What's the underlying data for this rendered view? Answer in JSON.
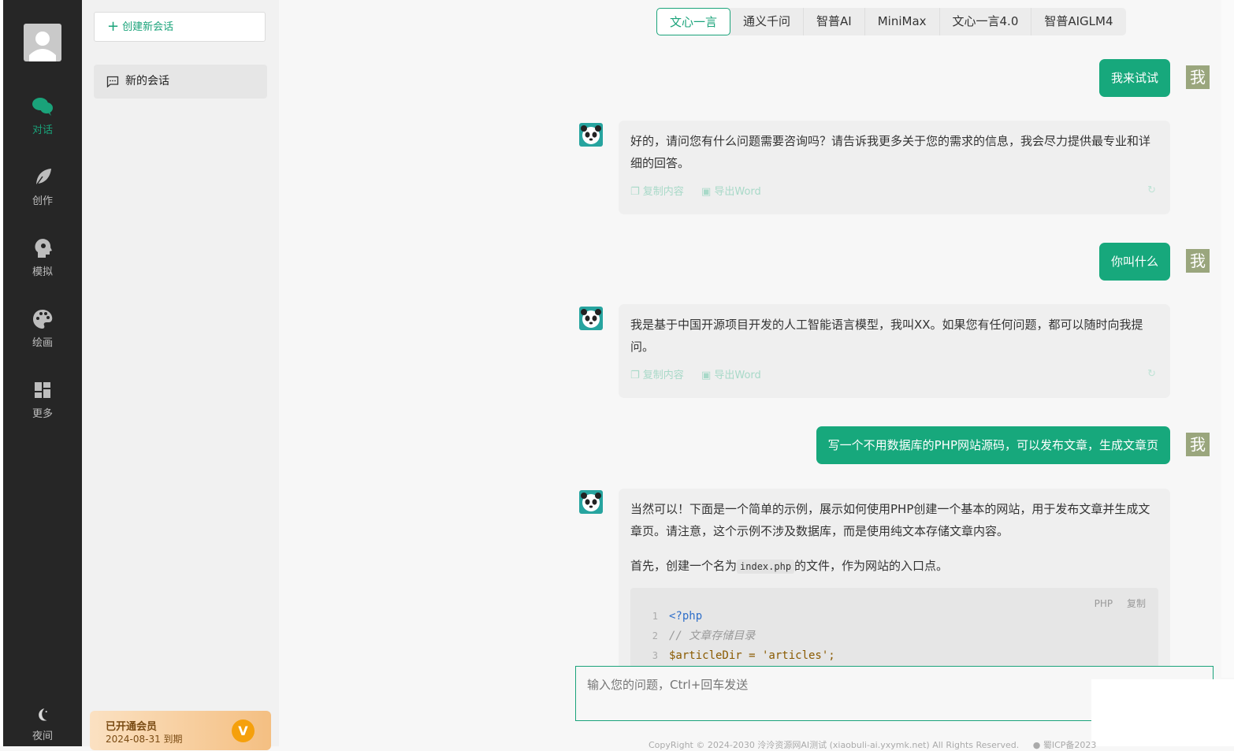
{
  "nav": {
    "items": [
      {
        "label": "对话",
        "icon": "chat-bubbles-icon",
        "active": true
      },
      {
        "label": "创作",
        "icon": "feather-icon",
        "active": false
      },
      {
        "label": "模拟",
        "icon": "head-profile-icon",
        "active": false
      },
      {
        "label": "绘画",
        "icon": "palette-icon",
        "active": false
      },
      {
        "label": "更多",
        "icon": "grid-icon",
        "active": false
      }
    ],
    "night_label": "夜间"
  },
  "sidebar": {
    "new_chat_label": "创建新会话",
    "sessions": [
      {
        "label": "新的会话"
      }
    ],
    "vip": {
      "title": "已开通会员",
      "expire": "2024-08-31 到期",
      "badge": "V"
    }
  },
  "models": {
    "tabs": [
      "文心一言",
      "通义千问",
      "智普AI",
      "MiniMax",
      "文心一言4.0",
      "智普AIGLM4"
    ],
    "active": "文心一言"
  },
  "chat": {
    "me_label": "我",
    "actions": {
      "copy": "复制内容",
      "export": "导出Word"
    },
    "messages": [
      {
        "role": "user",
        "text": "我来试试"
      },
      {
        "role": "bot",
        "text": "好的，请问您有什么问题需要咨询吗？请告诉我更多关于您的需求的信息，我会尽力提供最专业和详细的回答。"
      },
      {
        "role": "user",
        "text": "你叫什么"
      },
      {
        "role": "bot",
        "text": "我是基于中国开源项目开发的人工智能语言模型，我叫XX。如果您有任何问题，都可以随时向我提问。"
      },
      {
        "role": "user",
        "text": "写一个不用数据库的PHP网站源码，可以发布文章，生成文章页"
      },
      {
        "role": "bot",
        "text": "当然可以！下面是一个简单的示例，展示如何使用PHP创建一个基本的网站，用于发布文章并生成文章页。请注意，这个示例不涉及数据库，而是使用纯文本存储文章内容。",
        "para2_pre": "首先，创建一个名为",
        "para2_code": "index.php",
        "para2_post": "的文件，作为网站的入口点。",
        "code": {
          "lang": "PHP",
          "copy": "复制",
          "lines": [
            {
              "n": "1",
              "text": "<?php"
            },
            {
              "n": "2",
              "text": "// 文章存储目录"
            },
            {
              "n": "3",
              "text": "$articleDir = 'articles';"
            }
          ]
        }
      }
    ]
  },
  "input": {
    "placeholder": "输入您的问题，Ctrl+回车发送"
  },
  "footer": {
    "text": "CopyRight © 2024-2030 泠泠资源网AI测试 (xiaobuli-ai.yxymk.net) All Rights Reserved.",
    "icp": "蜀ICP备2023"
  }
}
